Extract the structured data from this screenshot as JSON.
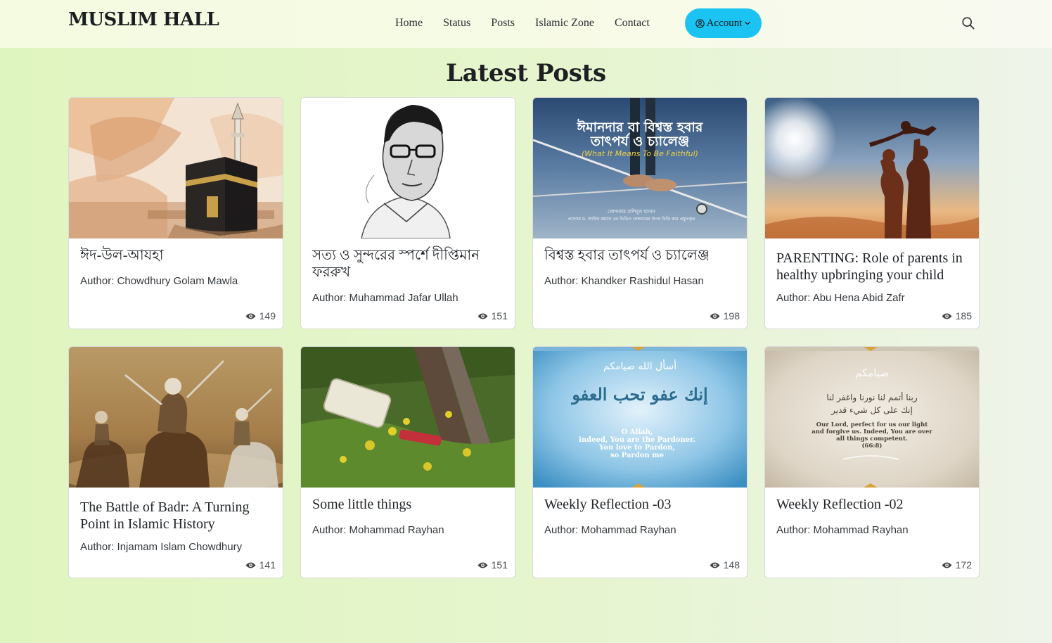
{
  "brand": "MUSLIM HALL",
  "nav": {
    "links": [
      "Home",
      "Status",
      "Posts",
      "Islamic Zone",
      "Contact"
    ],
    "account_label": "Account",
    "accent": "#1ac3f2"
  },
  "section_title": "Latest Posts",
  "posts": [
    {
      "title": "ঈদ-উল-আযহা",
      "author": "Author: Chowdhury Golam Mawla",
      "views": "149",
      "image": "kaaba-painting"
    },
    {
      "title": "সত্য ও সুন্দরের স্পর্শে দীপ্তিমান ফররুখ",
      "author": "Author: Muhammad Jafar Ullah",
      "views": "151",
      "image": "portrait-sketch"
    },
    {
      "title": "বিশ্বস্ত হবার তাৎপর্য ও চ্যালেঞ্জ",
      "author": "Author: Khandker Rashidul Hasan",
      "views": "198",
      "image": "tightrope-banner",
      "image_text": {
        "heading1": "ঈমানদার বা বিশ্বস্ত হবার",
        "heading2": "তাৎপর্য ও চ্যালেঞ্জ",
        "sub": "(What It Means To Be Faithful)",
        "foot1": "খোন্দকার রাশিদুল হাসান",
        "foot2": "প্রফেসর ড. আরিফ রহমান এর ভিডিও লেকচারের উপর ভিত্তি করে প্রস্তুতকৃত"
      }
    },
    {
      "title": "PARENTING: Role of parents in healthy upbringing your child",
      "author": "Author: Abu Hena Abid Zafr",
      "views": "185",
      "image": "parents-silhouette"
    },
    {
      "title": "The Battle of Badr: A Turning Point in Islamic History",
      "author": "Author: Injamam Islam Chowdhury",
      "views": "141",
      "image": "battle-painting"
    },
    {
      "title": "Some little things",
      "author": "Author: Mohammad Rayhan",
      "views": "151",
      "image": "garden-photo"
    },
    {
      "title": "Weekly Reflection -03",
      "author": "Author: Mohammad Rayhan",
      "views": "148",
      "image": "blue-calligraphy",
      "image_text": {
        "arabic1": "أسأل الله صيامكم",
        "arabic2": "إنك عفو تحب العفو",
        "eng1": "O Allah,",
        "eng2": "indeed, You are the Pardoner.",
        "eng3": "You love to Pardon,",
        "eng4": "so Pardon me"
      }
    },
    {
      "title": "Weekly Reflection -02",
      "author": "Author: Mohammad Rayhan",
      "views": "172",
      "image": "beige-calligraphy",
      "image_text": {
        "arabic1": "ربنا أتمم لنا نورنا واغفر لنا",
        "arabic2": "إنك على كل شيء قدير",
        "eng1": "Our Lord, perfect for us our light",
        "eng2": "and forgive us. Indeed, You are over",
        "eng3": "all things competent.",
        "eng4": "(66:8)"
      }
    }
  ]
}
